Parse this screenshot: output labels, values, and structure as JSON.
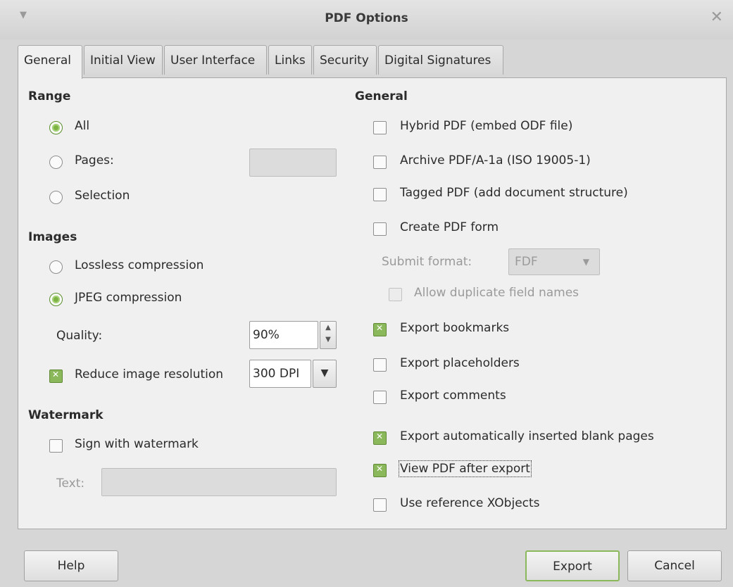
{
  "window": {
    "title": "PDF Options",
    "menu_icon": "chevron-down-icon",
    "close_icon": "close-icon"
  },
  "tabs": [
    {
      "label": "General",
      "active": true
    },
    {
      "label": "Initial View"
    },
    {
      "label": "User Interface"
    },
    {
      "label": "Links"
    },
    {
      "label": "Security"
    },
    {
      "label": "Digital Signatures"
    }
  ],
  "range": {
    "heading": "Range",
    "all": "All",
    "pages": "Pages:",
    "pages_value": "",
    "selection": "Selection",
    "selected": "All"
  },
  "images": {
    "heading": "Images",
    "lossless": "Lossless compression",
    "jpeg": "JPEG compression",
    "selected": "JPEG compression",
    "quality_label": "Quality:",
    "quality_value": "90%",
    "reduce_label": "Reduce image resolution",
    "reduce_checked": true,
    "resolution_value": "300 DPI"
  },
  "watermark": {
    "heading": "Watermark",
    "sign_label": "Sign with watermark",
    "sign_checked": false,
    "text_label": "Text:",
    "text_value": ""
  },
  "general": {
    "heading": "General",
    "hybrid": "Hybrid PDF (embed ODF file)",
    "archive": "Archive PDF/A-1a (ISO 19005-1)",
    "tagged": "Tagged PDF (add document structure)",
    "create_form": "Create PDF form",
    "submit_format_label": "Submit format:",
    "submit_format_value": "FDF",
    "allow_duplicate": "Allow duplicate field names",
    "export_bookmarks": "Export bookmarks",
    "export_placeholders": "Export placeholders",
    "export_comments": "Export comments",
    "export_blank_pages": "Export automatically inserted blank pages",
    "view_after_export": "View PDF after export",
    "use_reference_xobjects": "Use reference XObjects"
  },
  "buttons": {
    "help": "Help",
    "export": "Export",
    "cancel": "Cancel"
  }
}
